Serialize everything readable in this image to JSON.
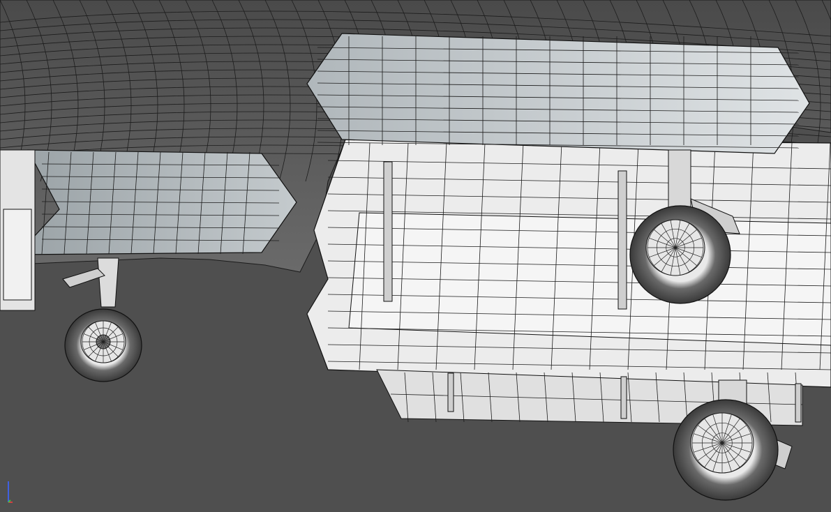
{
  "viewport": {
    "background": "#4f4f4f",
    "render_mode": "wireframe-on-shaded",
    "wire_color": "#1a1a1a",
    "shaded_color": "#e8e8e8",
    "dark_surface_color": "#5a5a5a",
    "objects": [
      {
        "name": "fuselage-underside",
        "tint": "#5c5c5c"
      },
      {
        "name": "fuel-tank-left",
        "tint": "#b9c0c4"
      },
      {
        "name": "fuel-tank-right",
        "tint": "#c5ccd0"
      },
      {
        "name": "weapons-bay-door",
        "tint": "#e9e9e9"
      },
      {
        "name": "landing-gear-left",
        "tint": "#d8d8d8"
      },
      {
        "name": "landing-gear-right",
        "tint": "#d8d8d8"
      },
      {
        "name": "landing-gear-rear",
        "tint": "#d8d8d8"
      }
    ]
  },
  "axis_gizmo": {
    "x_color": "#d24040",
    "y_color": "#40c040",
    "z_color": "#4060e0",
    "z_label": "z",
    "x_label": "x",
    "icon": "axis-tripod-icon"
  }
}
